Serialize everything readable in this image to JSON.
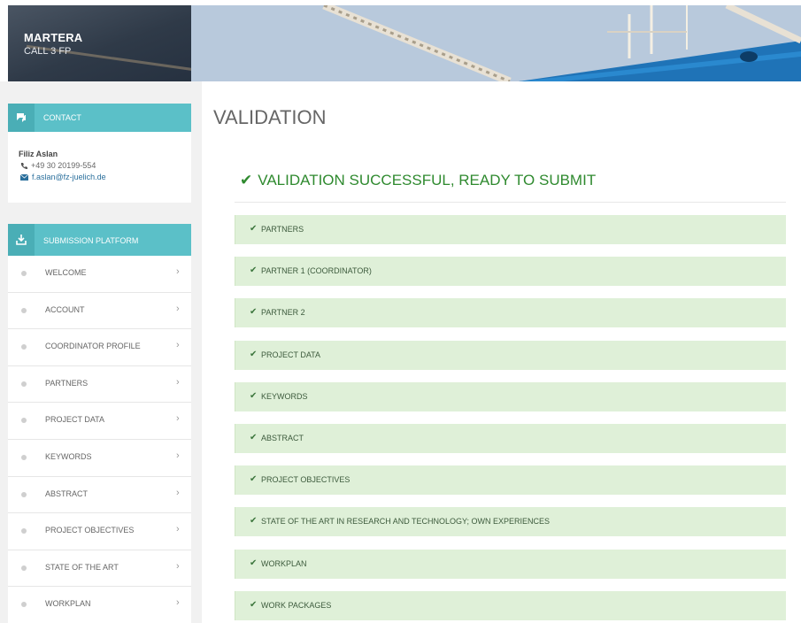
{
  "brand": {
    "title": "MARTERA",
    "subtitle": "CALL 3 FP"
  },
  "contact": {
    "header": "CONTACT",
    "name": "Filiz Aslan",
    "phone": "+49 30 20199-554",
    "email": "f.aslan@fz-juelich.de"
  },
  "submission": {
    "header": "SUBMISSION PLATFORM",
    "items": [
      {
        "label": "WELCOME"
      },
      {
        "label": "ACCOUNT"
      },
      {
        "label": "COORDINATOR PROFILE"
      },
      {
        "label": "PARTNERS"
      },
      {
        "label": "PROJECT DATA"
      },
      {
        "label": "KEYWORDS"
      },
      {
        "label": "ABSTRACT"
      },
      {
        "label": "PROJECT OBJECTIVES"
      },
      {
        "label": "STATE OF THE ART"
      },
      {
        "label": "WORKPLAN"
      }
    ]
  },
  "main": {
    "title": "VALIDATION",
    "status": "VALIDATION SUCCESSFUL, READY TO SUBMIT",
    "status_color": "#2f8a2f",
    "items": [
      {
        "label": "PARTNERS"
      },
      {
        "label": "PARTNER 1 (COORDINATOR)"
      },
      {
        "label": "PARTNER 2"
      },
      {
        "label": "PROJECT DATA"
      },
      {
        "label": "KEYWORDS"
      },
      {
        "label": "ABSTRACT"
      },
      {
        "label": "PROJECT OBJECTIVES"
      },
      {
        "label": "STATE OF THE ART IN RESEARCH AND TECHNOLOGY; OWN EXPERIENCES"
      },
      {
        "label": "WORKPLAN"
      },
      {
        "label": "WORK PACKAGES"
      }
    ]
  },
  "colors": {
    "accent": "#5bc0c8",
    "success_bg": "#dff0d8",
    "brand_bg": "#2f3a48"
  },
  "icons": {
    "contact": "chat-icon",
    "submission": "upload-icon",
    "phone": "phone-icon",
    "email": "envelope-icon",
    "menu_arrow": "chevron-right-icon",
    "status": "check-icon"
  }
}
